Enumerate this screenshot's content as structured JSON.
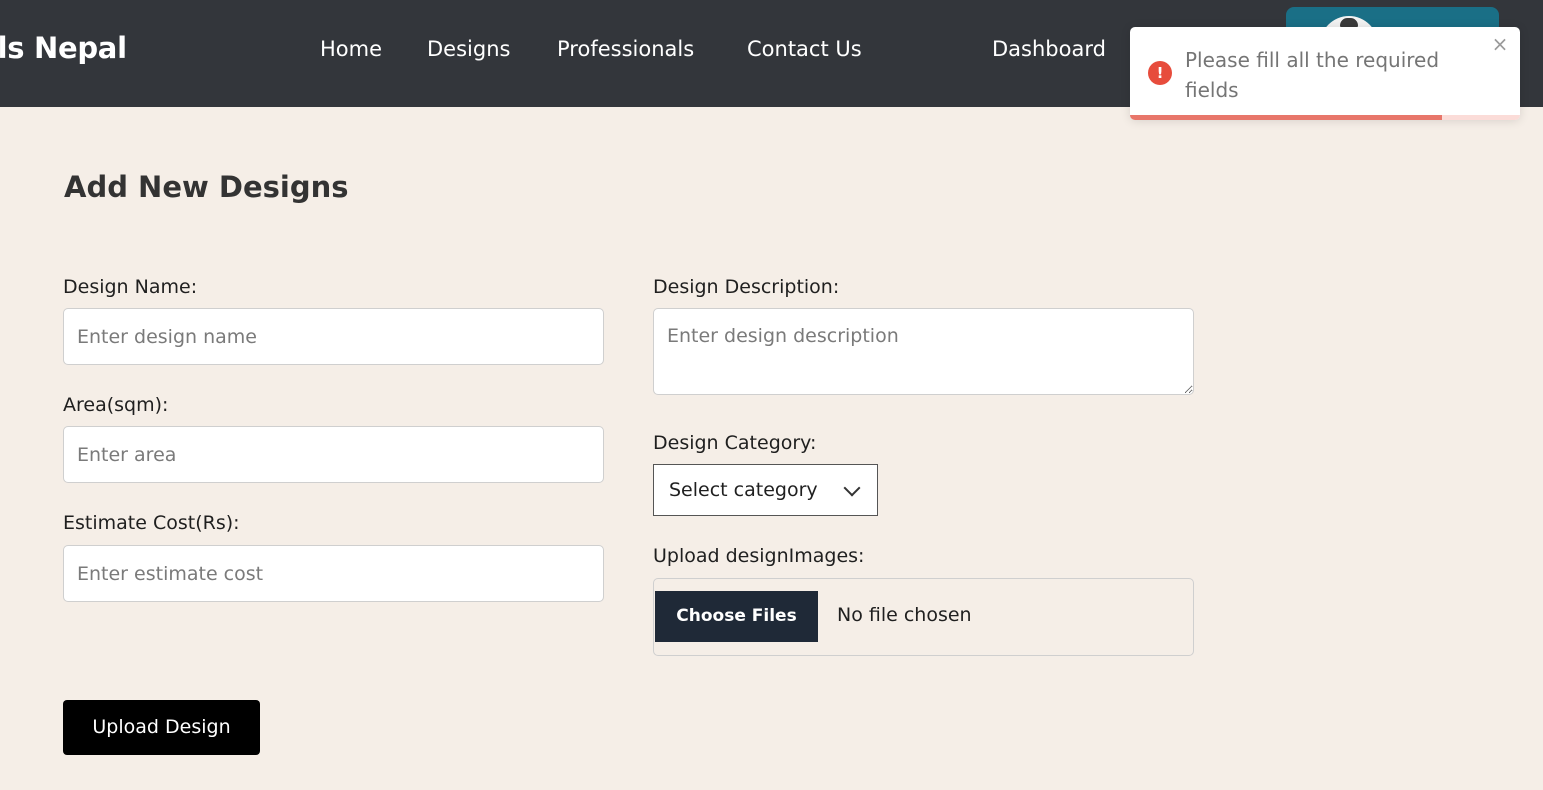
{
  "header": {
    "brand": "nals Nepal",
    "nav": {
      "home": "Home",
      "designs": "Designs",
      "professionals": "Professionals",
      "contact": "Contact Us",
      "dashboard": "Dashboard"
    }
  },
  "toast": {
    "message": "Please fill all the required fields",
    "close_glyph": "×",
    "icon_glyph": "!",
    "icon": "error-icon",
    "progress_fraction": 0.8,
    "color": "#e74c3c"
  },
  "form": {
    "title": "Add New Designs",
    "design_name": {
      "label": "Design Name:",
      "placeholder": "Enter design name"
    },
    "area": {
      "label": "Area(sqm):",
      "placeholder": "Enter area"
    },
    "estimate_cost": {
      "label": "Estimate Cost(Rs):",
      "placeholder": "Enter estimate cost"
    },
    "description": {
      "label": "Design Description:",
      "placeholder": "Enter design description"
    },
    "category": {
      "label": "Design Category:",
      "selected": "Select category"
    },
    "images": {
      "label": "Upload designImages:",
      "button": "Choose Files",
      "status": "No file chosen"
    },
    "submit": "Upload Design"
  },
  "colors": {
    "navbar": "#33363b",
    "profile_button": "#1a6f86",
    "page_background": "#f5eee7"
  }
}
